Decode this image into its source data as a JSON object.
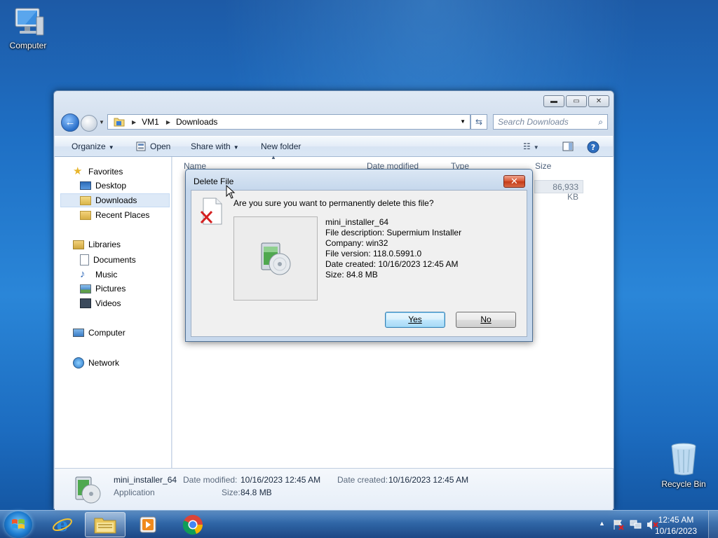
{
  "desktop": {
    "icons": [
      {
        "label": "Computer",
        "icon": "computer-icon"
      },
      {
        "label": "Recycle Bin",
        "icon": "recycle-bin-icon"
      }
    ]
  },
  "explorer": {
    "caption_buttons": {
      "minimize": "▬",
      "maximize": "▭",
      "close": "✕"
    },
    "address": {
      "parts": [
        "VM1",
        "Downloads"
      ]
    },
    "search_placeholder": "Search Downloads",
    "toolbar": {
      "organize": "Organize",
      "open": "Open",
      "share_with": "Share with",
      "new_folder": "New folder"
    },
    "nav_pane": {
      "favorites": "Favorites",
      "desktop": "Desktop",
      "downloads": "Downloads",
      "recent_places": "Recent Places",
      "libraries": "Libraries",
      "documents": "Documents",
      "music": "Music",
      "pictures": "Pictures",
      "videos": "Videos",
      "computer": "Computer",
      "network": "Network"
    },
    "columns": {
      "name": "Name",
      "date_modified": "Date modified",
      "type": "Type",
      "size": "Size"
    },
    "file_row": {
      "size": "86,933 KB"
    },
    "details_pane": {
      "name": "mini_installer_64",
      "type": "Application",
      "date_modified_label": "Date modified:",
      "date_modified": "10/16/2023 12:45 AM",
      "date_created_label": "Date created:",
      "date_created": "10/16/2023 12:45 AM",
      "size_label": "Size:",
      "size": "84.8 MB"
    }
  },
  "dialog": {
    "title": "Delete File",
    "close": "✕",
    "question": "Are you sure you want to permanently delete this file?",
    "file_name": "mini_installer_64",
    "description": "File description: Supermium Installer",
    "company": "Company: win32",
    "version": "File version: 118.0.5991.0",
    "created": "Date created: 10/16/2023 12:45 AM",
    "size": "Size: 84.8 MB",
    "yes": "Yes",
    "no": "No"
  },
  "taskbar": {
    "clock_time": "12:45 AM",
    "clock_date": "10/16/2023",
    "tray_arrow": "▲"
  }
}
